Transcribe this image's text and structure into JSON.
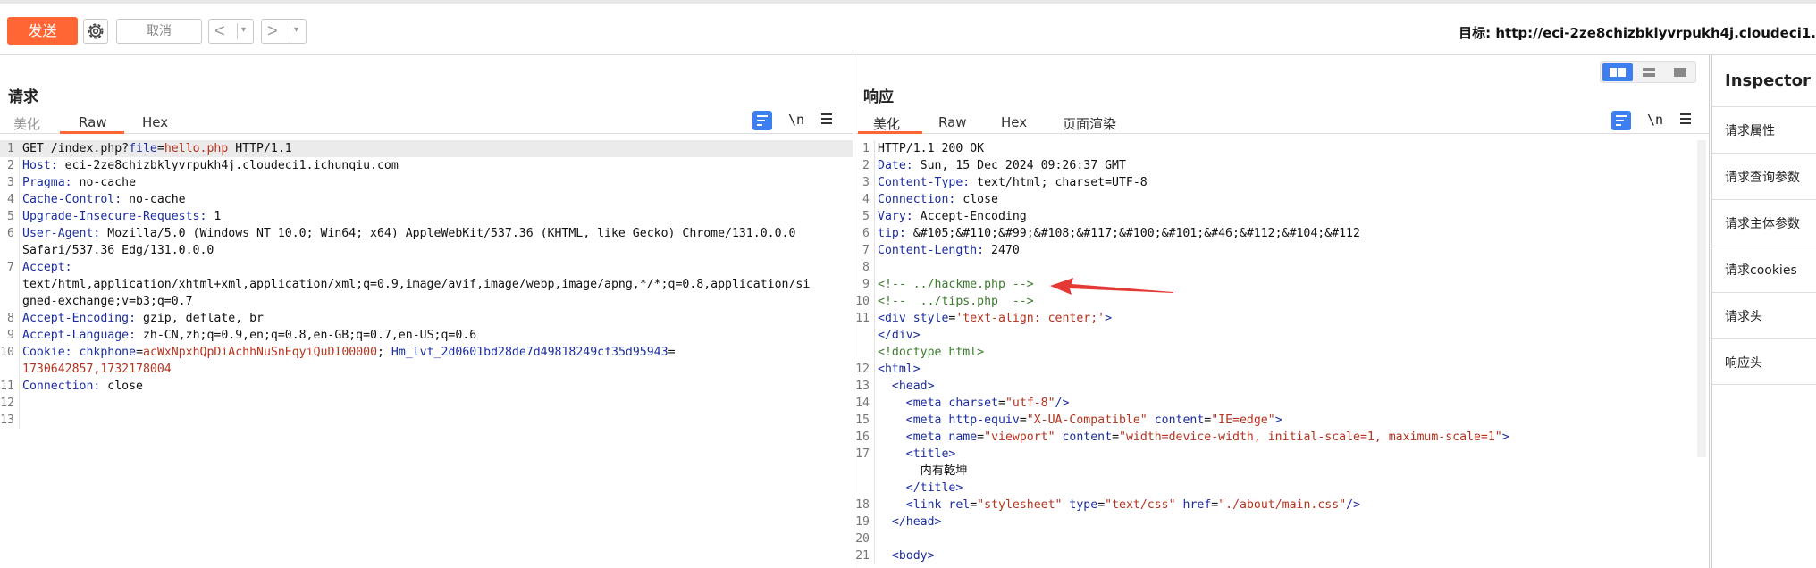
{
  "toolbar": {
    "send_label": "发送",
    "cancel_label": "取消",
    "back_glyph": "<",
    "forward_glyph": ">",
    "dropdown_glyph": "▾",
    "target_label": "目标: http://eci-2ze8chizbklyvrpukh4j.cloudeci1."
  },
  "icons": {
    "settings": "gear-icon",
    "wrap": "wrap-lines-icon",
    "newline": "\\n",
    "menu": "hamburger-menu-icon"
  },
  "colors": {
    "accent": "#ff6633",
    "blue": "#3d7ff0",
    "key": "#1c2da0",
    "value": "#b5321e",
    "comment": "#3c7a2e",
    "annotation_arrow": "#e53935"
  },
  "request": {
    "title": "请求",
    "tabs": [
      "美化",
      "Raw",
      "Hex"
    ],
    "active_tab": "Raw",
    "newline_label": "\\n",
    "lines": [
      {
        "n": "1",
        "segs": [
          [
            "d",
            "GET /index.php?"
          ],
          [
            "k",
            "file"
          ],
          [
            "d",
            "="
          ],
          [
            "v",
            "hello.php"
          ],
          [
            "d",
            " HTTP/1.1"
          ]
        ]
      },
      {
        "n": "2",
        "segs": [
          [
            "k",
            "Host:"
          ],
          [
            "d",
            " eci-2ze8chizbklyvrpukh4j.cloudeci1.ichunqiu.com"
          ]
        ]
      },
      {
        "n": "3",
        "segs": [
          [
            "k",
            "Pragma:"
          ],
          [
            "d",
            " no-cache"
          ]
        ]
      },
      {
        "n": "4",
        "segs": [
          [
            "k",
            "Cache-Control:"
          ],
          [
            "d",
            " no-cache"
          ]
        ]
      },
      {
        "n": "5",
        "segs": [
          [
            "k",
            "Upgrade-Insecure-Requests:"
          ],
          [
            "d",
            " 1"
          ]
        ]
      },
      {
        "n": "6",
        "segs": [
          [
            "k",
            "User-Agent:"
          ],
          [
            "d",
            " Mozilla/5.0 (Windows NT 10.0; Win64; x64) AppleWebKit/537.36 (KHTML, like Gecko) Chrome/131.0.0.0"
          ]
        ]
      },
      {
        "n": "",
        "segs": [
          [
            "d",
            "Safari/537.36 Edg/131.0.0.0"
          ]
        ]
      },
      {
        "n": "7",
        "segs": [
          [
            "k",
            "Accept:"
          ]
        ]
      },
      {
        "n": "",
        "segs": [
          [
            "d",
            "text/html,application/xhtml+xml,application/xml;q=0.9,image/avif,image/webp,image/apng,*/*;q=0.8,application/si"
          ]
        ]
      },
      {
        "n": "",
        "segs": [
          [
            "d",
            "gned-exchange;v=b3;q=0.7"
          ]
        ]
      },
      {
        "n": "8",
        "segs": [
          [
            "k",
            "Accept-Encoding:"
          ],
          [
            "d",
            " gzip, deflate, br"
          ]
        ]
      },
      {
        "n": "9",
        "segs": [
          [
            "k",
            "Accept-Language:"
          ],
          [
            "d",
            " zh-CN,zh;q=0.9,en;q=0.8,en-GB;q=0.7,en-US;q=0.6"
          ]
        ]
      },
      {
        "n": "10",
        "segs": [
          [
            "k",
            "Cookie:"
          ],
          [
            "d",
            " "
          ],
          [
            "k",
            "chkphone"
          ],
          [
            "d",
            "="
          ],
          [
            "v",
            "acWxNpxhQpDiAchhNuSnEqyiQuDI00000"
          ],
          [
            "d",
            "; "
          ],
          [
            "k",
            "Hm_lvt_2d0601bd28de7d49818249cf35d95943"
          ],
          [
            "d",
            "="
          ]
        ]
      },
      {
        "n": "",
        "segs": [
          [
            "v",
            "1730642857,1732178004"
          ]
        ]
      },
      {
        "n": "11",
        "segs": [
          [
            "k",
            "Connection:"
          ],
          [
            "d",
            " close"
          ]
        ]
      },
      {
        "n": "12",
        "segs": []
      },
      {
        "n": "13",
        "segs": []
      }
    ]
  },
  "response": {
    "title": "响应",
    "tabs": [
      "美化",
      "Raw",
      "Hex",
      "页面渲染"
    ],
    "active_tab": "美化",
    "newline_label": "\\n",
    "lines": [
      {
        "n": "1",
        "segs": [
          [
            "d",
            "HTTP/1.1 200 OK"
          ]
        ]
      },
      {
        "n": "2",
        "segs": [
          [
            "k",
            "Date:"
          ],
          [
            "d",
            " Sun, 15 Dec 2024 09:26:37 GMT"
          ]
        ]
      },
      {
        "n": "3",
        "segs": [
          [
            "k",
            "Content-Type:"
          ],
          [
            "d",
            " text/html; charset=UTF-8"
          ]
        ]
      },
      {
        "n": "4",
        "segs": [
          [
            "k",
            "Connection:"
          ],
          [
            "d",
            " close"
          ]
        ]
      },
      {
        "n": "5",
        "segs": [
          [
            "k",
            "Vary:"
          ],
          [
            "d",
            " Accept-Encoding"
          ]
        ]
      },
      {
        "n": "6",
        "segs": [
          [
            "k",
            "tip:"
          ],
          [
            "d",
            " &#105;&#110;&#99;&#108;&#117;&#100;&#101;&#46;&#112;&#104;&#112"
          ]
        ]
      },
      {
        "n": "7",
        "segs": [
          [
            "k",
            "Content-Length:"
          ],
          [
            "d",
            " 2470"
          ]
        ]
      },
      {
        "n": "8",
        "segs": []
      },
      {
        "n": "9",
        "segs": [
          [
            "c",
            "<!-- ../hackme.php -->"
          ]
        ]
      },
      {
        "n": "10",
        "segs": [
          [
            "c",
            "<!--  ../tips.php  -->"
          ]
        ]
      },
      {
        "n": "11",
        "segs": [
          [
            "tg",
            "<div "
          ],
          [
            "k",
            "style"
          ],
          [
            "d",
            "="
          ],
          [
            "sv",
            "'text-align: center;'"
          ],
          [
            "tg",
            ">"
          ]
        ]
      },
      {
        "n": "",
        "segs": [
          [
            "tg",
            "</div>"
          ]
        ]
      },
      {
        "n": "",
        "segs": [
          [
            "c",
            "<!doctype html>"
          ]
        ]
      },
      {
        "n": "12",
        "segs": [
          [
            "tg",
            "<html>"
          ]
        ]
      },
      {
        "n": "13",
        "segs": [
          [
            "d",
            "  "
          ],
          [
            "tg",
            "<head>"
          ]
        ]
      },
      {
        "n": "14",
        "segs": [
          [
            "d",
            "    "
          ],
          [
            "tg",
            "<meta "
          ],
          [
            "k",
            "charset"
          ],
          [
            "d",
            "="
          ],
          [
            "sv",
            "\"utf-8\""
          ],
          [
            "tg",
            "/>"
          ]
        ]
      },
      {
        "n": "15",
        "segs": [
          [
            "d",
            "    "
          ],
          [
            "tg",
            "<meta "
          ],
          [
            "k",
            "http-equiv"
          ],
          [
            "d",
            "="
          ],
          [
            "sv",
            "\"X-UA-Compatible\""
          ],
          [
            "d",
            " "
          ],
          [
            "k",
            "content"
          ],
          [
            "d",
            "="
          ],
          [
            "sv",
            "\"IE=edge\""
          ],
          [
            "tg",
            ">"
          ]
        ]
      },
      {
        "n": "16",
        "segs": [
          [
            "d",
            "    "
          ],
          [
            "tg",
            "<meta "
          ],
          [
            "k",
            "name"
          ],
          [
            "d",
            "="
          ],
          [
            "sv",
            "\"viewport\""
          ],
          [
            "d",
            " "
          ],
          [
            "k",
            "content"
          ],
          [
            "d",
            "="
          ],
          [
            "sv",
            "\"width=device-width, initial-scale=1, maximum-scale=1\""
          ],
          [
            "tg",
            ">"
          ]
        ]
      },
      {
        "n": "17",
        "segs": [
          [
            "d",
            "    "
          ],
          [
            "tg",
            "<title>"
          ]
        ]
      },
      {
        "n": "",
        "segs": [
          [
            "d",
            "      内有乾坤"
          ]
        ]
      },
      {
        "n": "",
        "segs": [
          [
            "d",
            "    "
          ],
          [
            "tg",
            "</title>"
          ]
        ]
      },
      {
        "n": "18",
        "segs": [
          [
            "d",
            "    "
          ],
          [
            "tg",
            "<link "
          ],
          [
            "k",
            "rel"
          ],
          [
            "d",
            "="
          ],
          [
            "sv",
            "\"stylesheet\""
          ],
          [
            "d",
            " "
          ],
          [
            "k",
            "type"
          ],
          [
            "d",
            "="
          ],
          [
            "sv",
            "\"text/css\""
          ],
          [
            "d",
            " "
          ],
          [
            "k",
            "href"
          ],
          [
            "d",
            "="
          ],
          [
            "sv",
            "\"./about/main.css\""
          ],
          [
            "tg",
            "/>"
          ]
        ]
      },
      {
        "n": "19",
        "segs": [
          [
            "d",
            "  "
          ],
          [
            "tg",
            "</head>"
          ]
        ]
      },
      {
        "n": "20",
        "segs": []
      },
      {
        "n": "21",
        "segs": [
          [
            "d",
            "  "
          ],
          [
            "tg",
            "<body>"
          ]
        ]
      }
    ]
  },
  "inspector": {
    "title": "Inspector",
    "items": [
      "请求属性",
      "请求查询参数",
      "请求主体参数",
      "请求cookies",
      "请求头",
      "响应头"
    ]
  }
}
